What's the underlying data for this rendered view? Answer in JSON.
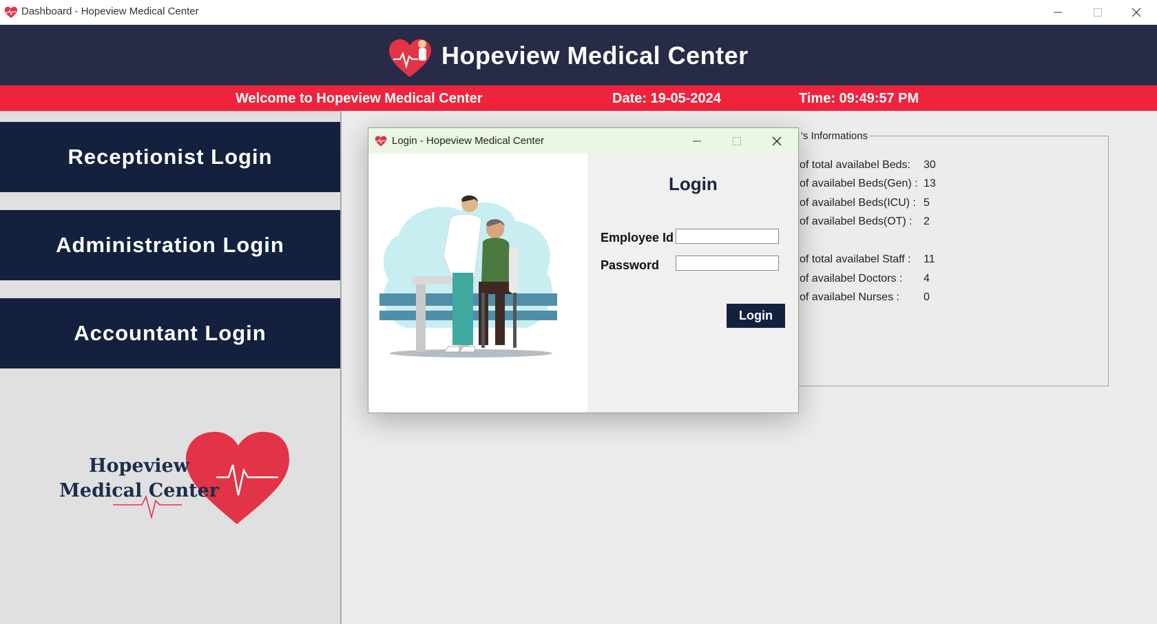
{
  "window": {
    "title": "Dashboard - Hopeview Medical Center"
  },
  "header": {
    "title": "Hopeview Medical Center"
  },
  "status_bar": {
    "welcome": "Welcome to Hopeview Medical Center",
    "date": "Date: 19-05-2024",
    "time": "Time: 09:49:57 PM"
  },
  "sidebar": {
    "buttons": [
      {
        "label": "Receptionist Login"
      },
      {
        "label": "Administration Login"
      },
      {
        "label": "Accountant Login"
      }
    ],
    "logo_text_line1": "Hopeview",
    "logo_text_line2": "Medical Center"
  },
  "info_panel": {
    "legend": "'s Informations",
    "rows": [
      {
        "label": "of total availabel Beds:",
        "value": "30"
      },
      {
        "label": "of availabel Beds(Gen) :",
        "value": "13"
      },
      {
        "label": "of availabel Beds(ICU) :",
        "value": "5"
      },
      {
        "label": "of availabel Beds(OT) :",
        "value": "2"
      },
      {
        "label": "of total availabel Staff :",
        "value": "11"
      },
      {
        "label": "of availabel Doctors :",
        "value": "4"
      },
      {
        "label": "of availabel Nurses :",
        "value": "0"
      }
    ]
  },
  "login_dialog": {
    "title": "Login - Hopeview Medical Center",
    "heading": "Login",
    "employee_id_label": "Employee Id",
    "employee_id_value": "",
    "password_label": "Password",
    "password_value": "",
    "button_label": "Login"
  },
  "colors": {
    "header_bg": "#272b47",
    "accent_red": "#ef233c",
    "button_navy": "#13213f"
  },
  "icons": [
    "app-heart-icon",
    "minimize-icon",
    "maximize-icon",
    "close-icon"
  ]
}
